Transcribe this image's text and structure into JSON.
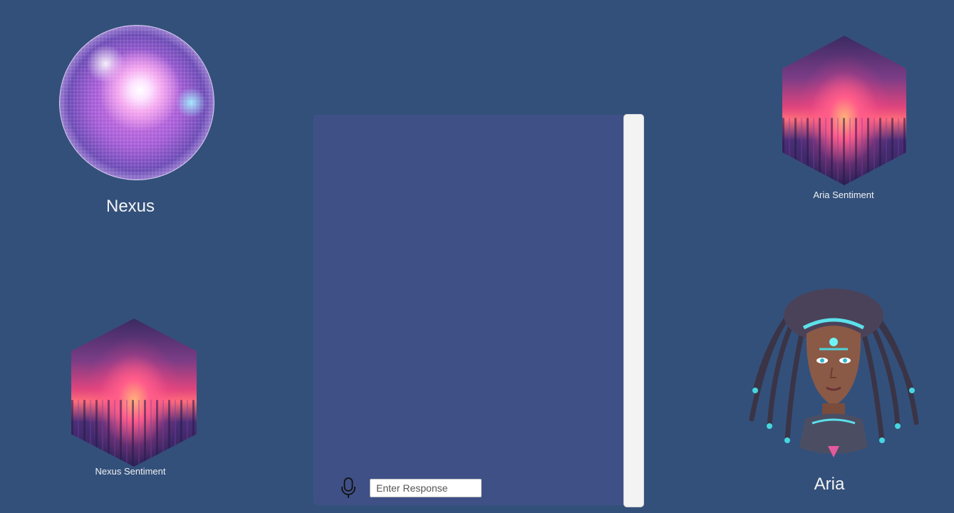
{
  "nexus": {
    "name": "Nexus",
    "sentiment_label": "Nexus Sentiment"
  },
  "aria": {
    "name": "Aria",
    "sentiment_label": "Aria Sentiment"
  },
  "chat": {
    "input_placeholder": "Enter Response",
    "input_value": "",
    "mic_icon": "microphone-icon"
  },
  "colors": {
    "background": "#33507b",
    "chat_panel": "#3f5087",
    "scrollbar": "#f3f3f3",
    "label_text": "#f4f4f4"
  }
}
